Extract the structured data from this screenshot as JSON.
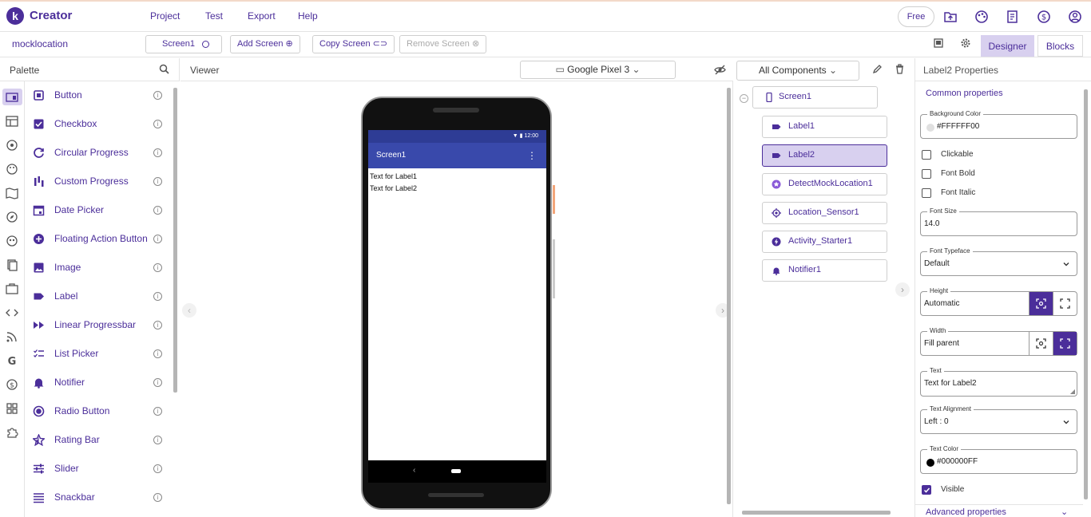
{
  "app": {
    "logo_letter": "k",
    "name": "Creator"
  },
  "menu": [
    "Project",
    "Test",
    "Export",
    "Help"
  ],
  "header_right": {
    "free_label": "Free",
    "icons": [
      "folder-upload-icon",
      "palette-icon",
      "tutorial-book-icon",
      "dollar-icon",
      "account-icon"
    ]
  },
  "toolbar": {
    "project_name": "mocklocation",
    "screen_select": "Screen1",
    "add_screen": "Add Screen",
    "copy_screen": "Copy Screen",
    "remove_screen": "Remove Screen",
    "designer_tab": "Designer",
    "blocks_tab": "Blocks"
  },
  "palette": {
    "title": "Palette",
    "items": [
      {
        "label": "Button",
        "icon": "button-icon"
      },
      {
        "label": "Checkbox",
        "icon": "checkbox-icon"
      },
      {
        "label": "Circular Progress",
        "icon": "circular-progress-icon"
      },
      {
        "label": "Custom Progress",
        "icon": "custom-progress-icon"
      },
      {
        "label": "Date Picker",
        "icon": "calendar-icon"
      },
      {
        "label": "Floating Action Button",
        "icon": "plus-circle-icon"
      },
      {
        "label": "Image",
        "icon": "image-icon"
      },
      {
        "label": "Label",
        "icon": "label-icon"
      },
      {
        "label": "Linear Progressbar",
        "icon": "fast-forward-icon"
      },
      {
        "label": "List Picker",
        "icon": "list-icon"
      },
      {
        "label": "Notifier",
        "icon": "bell-icon"
      },
      {
        "label": "Radio Button",
        "icon": "radio-icon"
      },
      {
        "label": "Rating Bar",
        "icon": "star-icon"
      },
      {
        "label": "Slider",
        "icon": "slider-icon"
      },
      {
        "label": "Snackbar",
        "icon": "snackbar-icon"
      }
    ]
  },
  "viewer": {
    "title": "Viewer",
    "device": "Google Pixel 3",
    "phone": {
      "time": "12:00",
      "screen_title": "Screen1",
      "labels": [
        "Text for Label1",
        "Text for Label2"
      ]
    }
  },
  "components": {
    "selector": "All Components",
    "root": "Screen1",
    "children": [
      {
        "label": "Label1",
        "selected": false,
        "icon": "label-icon"
      },
      {
        "label": "Label2",
        "selected": true,
        "icon": "label-icon"
      },
      {
        "label": "DetectMockLocation1",
        "selected": false,
        "icon": "extension-star-icon"
      },
      {
        "label": "Location_Sensor1",
        "selected": false,
        "icon": "location-target-icon"
      },
      {
        "label": "Activity_Starter1",
        "selected": false,
        "icon": "activity-bolt-icon"
      },
      {
        "label": "Notifier1",
        "selected": false,
        "icon": "bell-icon"
      }
    ]
  },
  "properties": {
    "title": "Label2 Properties",
    "common": "Common properties",
    "background_color": {
      "label": "Background Color",
      "value": "#FFFFFF00",
      "swatch": "#e0e0e0"
    },
    "checks": [
      {
        "label": "Clickable",
        "checked": false
      },
      {
        "label": "Font Bold",
        "checked": false
      },
      {
        "label": "Font Italic",
        "checked": false
      }
    ],
    "font_size": {
      "label": "Font Size",
      "value": "14.0"
    },
    "font_typeface": {
      "label": "Font Typeface",
      "value": "Default"
    },
    "height": {
      "label": "Height",
      "value": "Automatic"
    },
    "width": {
      "label": "Width",
      "value": "Fill parent"
    },
    "text": {
      "label": "Text",
      "value": "Text for Label2"
    },
    "text_alignment": {
      "label": "Text Alignment",
      "value": "Left : 0"
    },
    "text_color": {
      "label": "Text Color",
      "value": "#000000FF",
      "swatch": "#000000"
    },
    "visible": {
      "label": "Visible",
      "checked": true
    },
    "advanced": "Advanced properties"
  },
  "colors": {
    "accent": "#4b2e9a",
    "selected_bg": "#d8d0ef",
    "appbar": "#3949ab"
  }
}
